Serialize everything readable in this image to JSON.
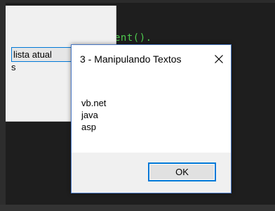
{
  "background_code": {
    "snippet": "ent()."
  },
  "back_form": {
    "button_label": "lista atual",
    "fragment": "s"
  },
  "dialog": {
    "title": "3 - Manipulando Textos",
    "close_icon": "close-icon",
    "lines": [
      "vb.net",
      "java",
      "asp"
    ],
    "ok_label": "OK"
  },
  "colors": {
    "accent": "#0078d7",
    "code_green": "#4ec94e",
    "editor_bg": "#1e1e1e",
    "dialog_footer": "#f0f0f0"
  }
}
